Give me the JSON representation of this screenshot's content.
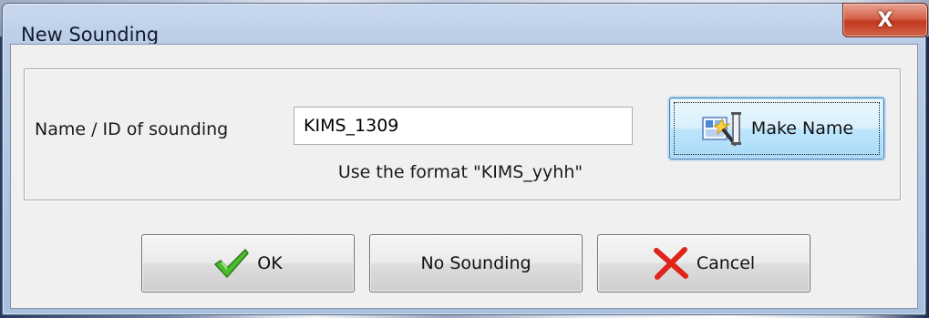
{
  "window": {
    "title": "New Sounding",
    "close_glyph": "X"
  },
  "form": {
    "name_label": "Name / ID of sounding",
    "name_value": "KIMS_1309",
    "hint": "Use the format \"KIMS_yyhh\"",
    "make_name_label": "Make Name",
    "make_name_icon": "magic-wand-icon"
  },
  "buttons": {
    "ok_label": "OK",
    "ok_icon": "checkmark-icon",
    "no_sounding_label": "No Sounding",
    "cancel_label": "Cancel",
    "cancel_icon": "red-x-icon"
  },
  "colors": {
    "ok_check": "#3fa52b",
    "cancel_x": "#e01b14",
    "close_button": "#c7432a"
  }
}
